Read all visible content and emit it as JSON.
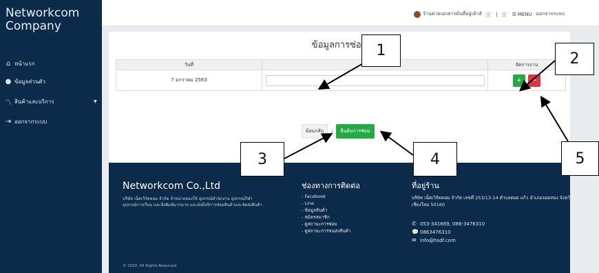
{
  "sidebar": {
    "brand": "Networkcom\nCompany",
    "items": [
      {
        "label": "หน้าแรก",
        "icon": "home-icon",
        "glyph": "🏠"
      },
      {
        "label": "ข้อมูลส่วนตัว",
        "icon": "user-icon",
        "glyph": "👤"
      },
      {
        "label": "สินค้าและบริการ",
        "icon": "chart-icon",
        "glyph": "〽",
        "caret": "▼"
      },
      {
        "label": "ออกจากระบบ",
        "icon": "logout-icon",
        "glyph": "⇥"
      }
    ]
  },
  "topbar": {
    "shop_name": "ร้านค่ายเอกสารมั่นที่อยู่เห้าส์",
    "cart_icon": "cart-icon",
    "divider": "|",
    "menu_label": "MENU",
    "logout_label": "ออกจากระบบ"
  },
  "panel": {
    "title": "ข้อมูลการซ่อม",
    "table": {
      "headers": [
        "วันที่",
        "รายละเอียด",
        "จัดการงาน"
      ],
      "rows": [
        {
          "date": "7 มกราคม 2563",
          "detail": ""
        }
      ],
      "add_glyph": "+",
      "delete_glyph": "−"
    },
    "back_label": "ย้อนกลับ",
    "sep": "|",
    "confirm_label": "ยืนยันการซ่อม"
  },
  "footer": {
    "brand": "Networkcom Co.,Ltd",
    "desc": "บริษัท เน็ตเวิร์คคอม จำกัด จำหน่ายของใช้ อุปกรณ์สำนักงาน อุปกรณ์กีฬา อุปกรณ์การเรียน และสิ่งพิมพ์มากมาย และยังมีบริการซ่อมสินค้าและจัดส่งสินค้า",
    "contact_title": "ช่องทางการติดต่อ",
    "links": [
      "- Facebook",
      "- Line",
      "- ข้อมูลสินค้า",
      "- สมัครสมาชิก",
      "- ดูสถานะการซ่อม",
      "- ดูสถานะการขนส่งสินค้า"
    ],
    "addr_title": "ที่อยู่ร้าน",
    "address": "บริษัท เน็ตเวิร์คคอม จำกัด เลขที่ 253/13-14 ตำบลตอย แก้ว อำเภอจอมทอง จังหวัดเชียงใหม่ 50160",
    "phone": "053-341669, 086-3476310",
    "line": "0863476310",
    "email": "info@hsdf.com",
    "copyright": "© 2020. All Rights Reserved"
  },
  "callouts": [
    "1",
    "2",
    "3",
    "4",
    "5"
  ],
  "colors": {
    "sidebar": "#0c2b4a",
    "green": "#28a745",
    "red": "#dc3545"
  }
}
